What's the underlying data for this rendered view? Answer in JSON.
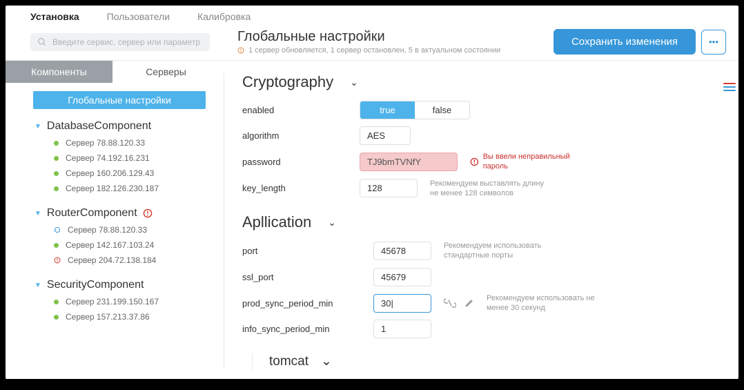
{
  "topnav": {
    "items": [
      "Установка",
      "Пользователи",
      "Калибровка"
    ],
    "active": 0
  },
  "search": {
    "placeholder": "Введите сервис, сервер или параметр"
  },
  "page": {
    "title": "Глобальные настройки",
    "status": "1 сервер обновляется, 1 сервер остановлен, 5 в актуальном состоянии"
  },
  "actions": {
    "save": "Сохранить изменения",
    "more": "•••"
  },
  "side_tabs": {
    "components": "Компоненты",
    "servers": "Серверы",
    "active": 0
  },
  "global_pill": "Глобальные настройки",
  "components": [
    {
      "name": "DatabaseComponent",
      "warn": false,
      "servers": [
        {
          "label": "Сервер 78.88.120.33",
          "status": "ok"
        },
        {
          "label": "Сервер 74.192.16.231",
          "status": "ok"
        },
        {
          "label": "Сервер 160.206.129.43",
          "status": "ok"
        },
        {
          "label": "Сервер 182.126.230.187",
          "status": "ok"
        }
      ]
    },
    {
      "name": "RouterComponent",
      "warn": true,
      "servers": [
        {
          "label": "Сервер 78.88.120.33",
          "status": "reload"
        },
        {
          "label": "Сервер 142.167.103.24",
          "status": "ok"
        },
        {
          "label": "Сервер 204.72.138.184",
          "status": "err"
        }
      ]
    },
    {
      "name": "SecurityComponent",
      "warn": false,
      "servers": [
        {
          "label": "Сервер 231.199.150.167",
          "status": "ok"
        },
        {
          "label": "Сервер 157.213.37.86",
          "status": "ok"
        }
      ]
    }
  ],
  "sections": {
    "crypto": {
      "title": "Cryptography",
      "rows": {
        "enabled": {
          "label": "enabled",
          "true": "true",
          "false": "false",
          "value": true
        },
        "algorithm": {
          "label": "algorithm",
          "value": "AES"
        },
        "password": {
          "label": "password",
          "value": "TJ9bmTVNfY",
          "error": "Вы ввели неправильный пароль"
        },
        "key_length": {
          "label": "key_length",
          "value": "128",
          "hint1": "Рекомендуем выставлять длину",
          "hint2": "не менее 128 символов"
        }
      }
    },
    "app": {
      "title": "Apllication",
      "rows": {
        "port": {
          "label": "port",
          "value": "45678",
          "hint1": "Рекомендуем использовать",
          "hint2": "стандартные порты"
        },
        "ssl_port": {
          "label": "ssl_port",
          "value": "45679"
        },
        "prod": {
          "label": "prod_sync_period_min",
          "value": "30|",
          "hint1": "Рекомендуем использовать не",
          "hint2": "менее 30 секунд"
        },
        "info": {
          "label": "info_sync_period_min",
          "value": "1"
        }
      },
      "sub": {
        "title": "tomcat"
      }
    }
  }
}
